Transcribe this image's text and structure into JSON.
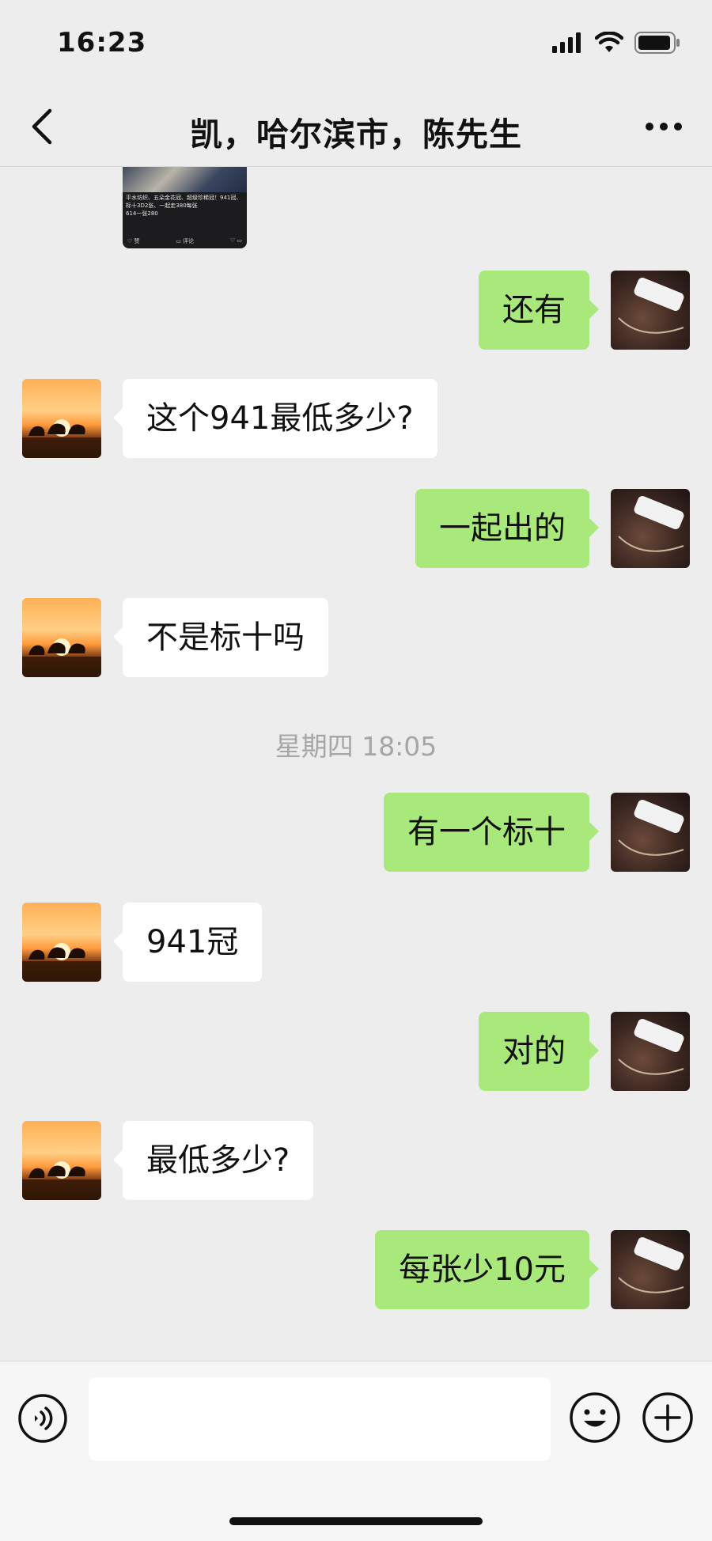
{
  "status_bar": {
    "time": "16:23",
    "icons": [
      "signal-icon",
      "wifi-icon",
      "battery-icon"
    ]
  },
  "nav": {
    "title": "凯，哈尔滨市，陈先生",
    "back_icon": "chevron-left-icon",
    "more_icon": "more-dots-icon"
  },
  "shared_image": {
    "caption": "平水坊织、五朵金花冠、超级珍稀冠！941冠、标十3D2张、一起走380每张",
    "caption_line2": "614一张280",
    "like_label": "赞",
    "comment_label": "评论"
  },
  "messages": [
    {
      "side": "right",
      "text": "还有"
    },
    {
      "side": "left",
      "text": "这个941最低多少?"
    },
    {
      "side": "right",
      "text": "一起出的"
    },
    {
      "side": "left",
      "text": "不是标十吗"
    },
    {
      "side": "right",
      "text": "有一个标十"
    },
    {
      "side": "left",
      "text": "941冠"
    },
    {
      "side": "right",
      "text": "对的"
    },
    {
      "side": "left",
      "text": "最低多少?"
    },
    {
      "side": "right",
      "text": "每张少10元"
    }
  ],
  "timestamp": "星期四 18:05",
  "input_bar": {
    "voice_icon": "voice-icon",
    "input_value": "",
    "emoji_icon": "emoji-icon",
    "plus_icon": "plus-icon"
  },
  "colors": {
    "background": "#ededed",
    "bubble_self": "#a9e97b",
    "bubble_other": "#ffffff",
    "timestamp": "#a6a6a6"
  }
}
